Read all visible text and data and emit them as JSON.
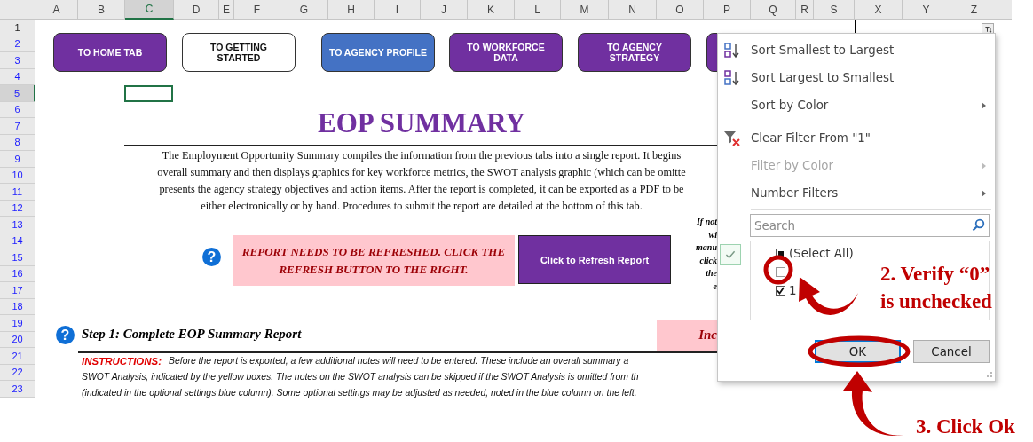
{
  "sheet": {
    "columns": [
      {
        "label": "A",
        "selected": false
      },
      {
        "label": "B",
        "selected": false
      },
      {
        "label": "C",
        "selected": true
      },
      {
        "label": "D",
        "selected": false
      },
      {
        "label": "E",
        "selected": false
      },
      {
        "label": "F",
        "selected": false
      },
      {
        "label": "G",
        "selected": false
      },
      {
        "label": "H",
        "selected": false
      },
      {
        "label": "I",
        "selected": false
      },
      {
        "label": "J",
        "selected": false
      },
      {
        "label": "K",
        "selected": false
      },
      {
        "label": "L",
        "selected": false
      },
      {
        "label": "M",
        "selected": false
      },
      {
        "label": "N",
        "selected": false
      },
      {
        "label": "O",
        "selected": false
      },
      {
        "label": "P",
        "selected": false
      },
      {
        "label": "Q",
        "selected": false
      },
      {
        "label": "R",
        "selected": false
      },
      {
        "label": "S",
        "selected": false
      },
      {
        "label": "X",
        "selected": false
      },
      {
        "label": "Y",
        "selected": false
      },
      {
        "label": "Z",
        "selected": false
      }
    ],
    "rows": [
      {
        "label": "1",
        "selected": false,
        "filtered": false
      },
      {
        "label": "2",
        "selected": false,
        "filtered": true
      },
      {
        "label": "3",
        "selected": false,
        "filtered": true
      },
      {
        "label": "4",
        "selected": false,
        "filtered": true
      },
      {
        "label": "5",
        "selected": true,
        "filtered": true
      },
      {
        "label": "6",
        "selected": false,
        "filtered": true
      },
      {
        "label": "7",
        "selected": false,
        "filtered": true
      },
      {
        "label": "8",
        "selected": false,
        "filtered": true
      },
      {
        "label": "9",
        "selected": false,
        "filtered": true
      },
      {
        "label": "10",
        "selected": false,
        "filtered": true
      },
      {
        "label": "11",
        "selected": false,
        "filtered": true
      },
      {
        "label": "12",
        "selected": false,
        "filtered": true
      },
      {
        "label": "13",
        "selected": false,
        "filtered": true
      },
      {
        "label": "14",
        "selected": false,
        "filtered": true
      },
      {
        "label": "15",
        "selected": false,
        "filtered": true
      },
      {
        "label": "16",
        "selected": false,
        "filtered": true
      },
      {
        "label": "17",
        "selected": false,
        "filtered": true
      },
      {
        "label": "18",
        "selected": false,
        "filtered": true
      },
      {
        "label": "19",
        "selected": false,
        "filtered": true
      },
      {
        "label": "20",
        "selected": false,
        "filtered": true
      },
      {
        "label": "21",
        "selected": false,
        "filtered": true
      },
      {
        "label": "22",
        "selected": false,
        "filtered": true
      },
      {
        "label": "23",
        "selected": false,
        "filtered": true
      }
    ]
  },
  "nav_buttons": [
    {
      "label": "TO HOME TAB",
      "color": "#7030a0"
    },
    {
      "label": "TO GETTING STARTED",
      "color": "#ffffff"
    },
    {
      "label": "TO AGENCY PROFILE",
      "color": "#4472c4"
    },
    {
      "label": "TO WORKFORCE DATA",
      "color": "#7030a0"
    },
    {
      "label": "TO AGENCY STRATEGY",
      "color": "#7030a0"
    },
    {
      "color": "#7030a0"
    }
  ],
  "title": "EOP SUMMARY",
  "intro_lines": [
    "The Employment Opportunity Summary compiles the information from the previous tabs into a single report. It begins",
    "overall summary and then displays graphics for key workforce metrics, the SWOT analysis graphic (which can be omitte",
    "presents the agency strategy objectives and action items. After the report is completed, it can be exported as a PDF to be",
    "either electronically or by hand. Procedures to submit the report are detailed at the bottom of this tab."
  ],
  "refresh": {
    "help": "?",
    "notice_lines": [
      "REPORT NEEDS TO BE REFRESHED. CLICK THE",
      "REFRESH BUTTON TO THE RIGHT."
    ],
    "button": "Click to Refresh Report",
    "side_note_lines": [
      "If not",
      "wi",
      "manu",
      "click",
      "the",
      "e"
    ]
  },
  "step": {
    "help": "?",
    "title": "Step 1: Complete EOP Summary Report",
    "status": "Inc"
  },
  "instructions": {
    "label": "INSTRUCTIONS:",
    "lines": [
      "Before the report is exported, a few additional notes will need to be entered. These include an overall summary a",
      "SWOT Analysis, indicated by the yellow boxes. The notes on the SWOT analysis can be skipped if the SWOT Analysis is omitted from th",
      "(indicated in the optional settings blue column). Some optional settings may be adjusted as needed, noted in the blue column on the left."
    ]
  },
  "filter_menu": {
    "items": [
      {
        "label": "Sort Smallest to Largest",
        "kind": "sort-ascending",
        "disabled": false,
        "submenu": false
      },
      {
        "label": "Sort Largest to Smallest",
        "kind": "sort-descending",
        "disabled": false,
        "submenu": false
      },
      {
        "label": "Sort by Color",
        "kind": "plain",
        "disabled": false,
        "submenu": true
      },
      {
        "kind": "separator"
      },
      {
        "label": "Clear Filter From \"1\"",
        "kind": "clear-filter",
        "disabled": false,
        "submenu": false
      },
      {
        "label": "Filter by Color",
        "kind": "plain",
        "disabled": true,
        "submenu": true
      },
      {
        "label": "Number Filters",
        "kind": "plain",
        "disabled": false,
        "submenu": true
      },
      {
        "kind": "separator"
      }
    ],
    "search": {
      "placeholder": "Search"
    },
    "values": [
      {
        "label": "(Select All)",
        "checked": false,
        "partial": true
      },
      {
        "checked": false,
        "partial": false
      },
      {
        "label": "1",
        "checked": true,
        "partial": false
      }
    ],
    "ok": "OK",
    "cancel": "Cancel"
  },
  "annotations": [
    {
      "lines": [
        "2. Verify “0”",
        "is unchecked"
      ]
    },
    {
      "lines": [
        "3. Click Ok"
      ]
    }
  ]
}
